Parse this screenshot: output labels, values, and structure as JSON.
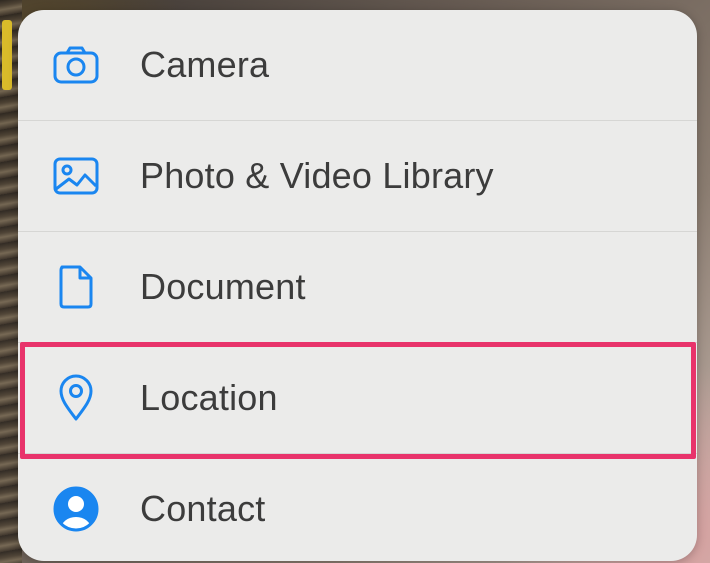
{
  "menu": {
    "items": [
      {
        "id": "camera",
        "label": "Camera",
        "icon": "camera-icon"
      },
      {
        "id": "photo-video-library",
        "label": "Photo & Video Library",
        "icon": "photo-icon"
      },
      {
        "id": "document",
        "label": "Document",
        "icon": "document-icon"
      },
      {
        "id": "location",
        "label": "Location",
        "icon": "location-pin-icon"
      },
      {
        "id": "contact",
        "label": "Contact",
        "icon": "contact-icon"
      }
    ]
  },
  "colors": {
    "icon_blue": "#1a86f0",
    "highlight": "#e8336b",
    "menu_background": "#ebebea",
    "label_text": "#3c3c3c"
  }
}
